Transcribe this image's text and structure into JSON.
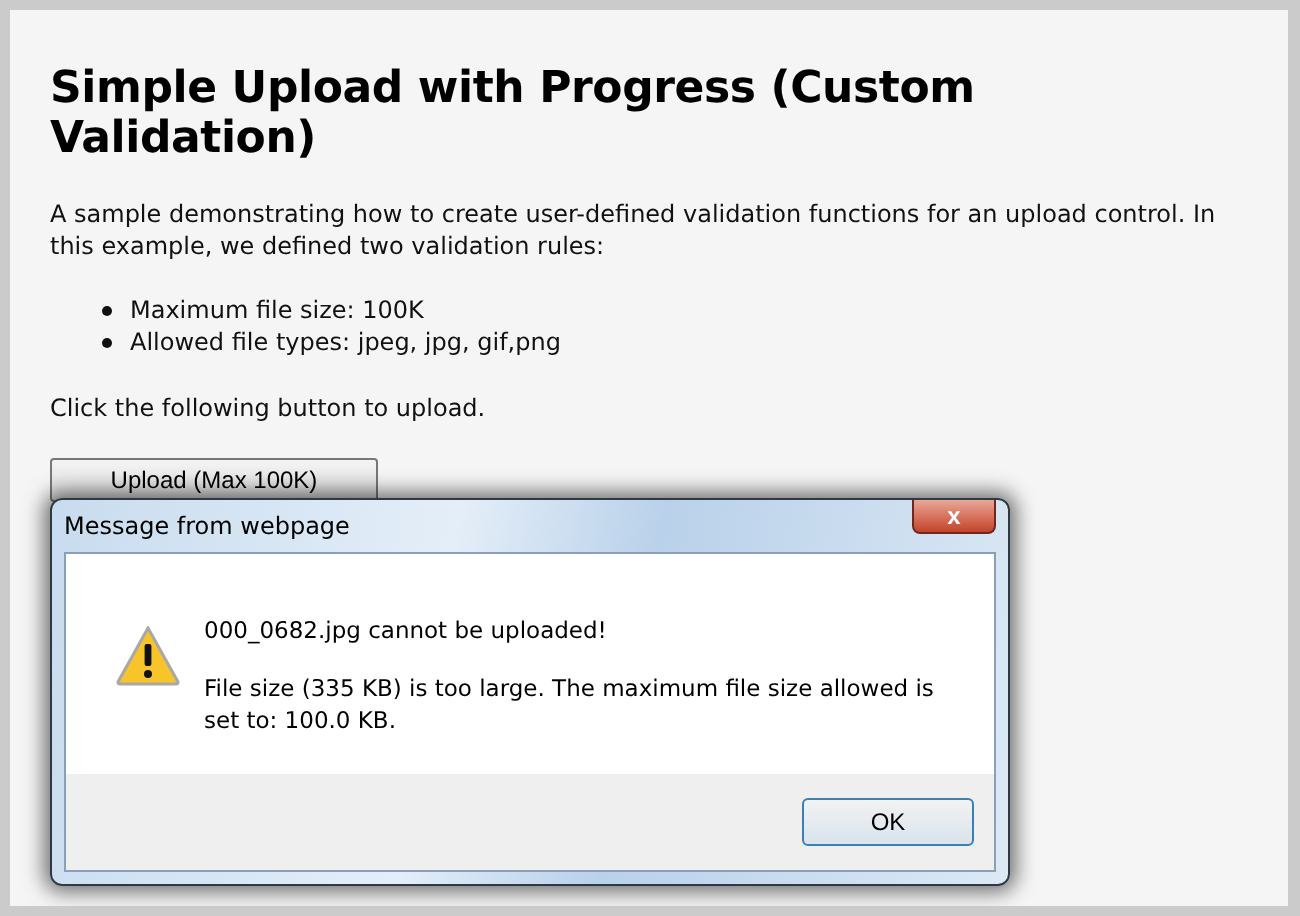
{
  "page": {
    "heading": "Simple Upload with Progress (Custom Validation)",
    "intro": "A sample demonstrating how to create user-defined validation functions for an upload control. In this example, we defined two validation rules:",
    "rules": [
      "Maximum file size: 100K",
      "Allowed file types: jpeg, jpg, gif,png"
    ],
    "instruction": "Click the following button to upload.",
    "upload_button": "Upload (Max 100K)"
  },
  "dialog": {
    "title": "Message from webpage",
    "close": "x",
    "messages": [
      "000_0682.jpg cannot be uploaded!",
      "File size (335 KB) is too large. The maximum file size allowed is set to: 100.0 KB."
    ],
    "buttons": [
      "OK"
    ]
  }
}
